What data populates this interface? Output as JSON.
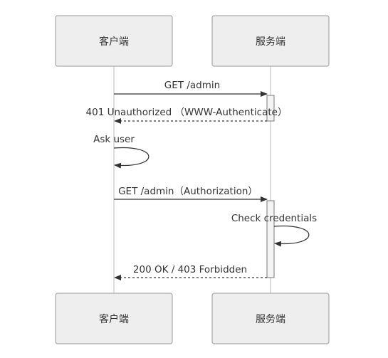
{
  "diagram": {
    "actors": [
      {
        "id": "client",
        "label": "客户端"
      },
      {
        "id": "server",
        "label": "服务端"
      }
    ],
    "messages": [
      {
        "label": "GET /admin",
        "from": "client",
        "to": "server",
        "style": "solid"
      },
      {
        "label": "401 Unauthorized （WWW-Authenticate）",
        "from": "server",
        "to": "client",
        "style": "dotted"
      },
      {
        "label": "Ask user",
        "from": "client",
        "to": "client",
        "style": "self"
      },
      {
        "label": "GET /admin（Authorization）",
        "from": "client",
        "to": "server",
        "style": "solid"
      },
      {
        "label": "Check credentials",
        "from": "server",
        "to": "server",
        "style": "self"
      },
      {
        "label": "200 OK / 403 Forbidden",
        "from": "server",
        "to": "client",
        "style": "dotted"
      }
    ]
  }
}
